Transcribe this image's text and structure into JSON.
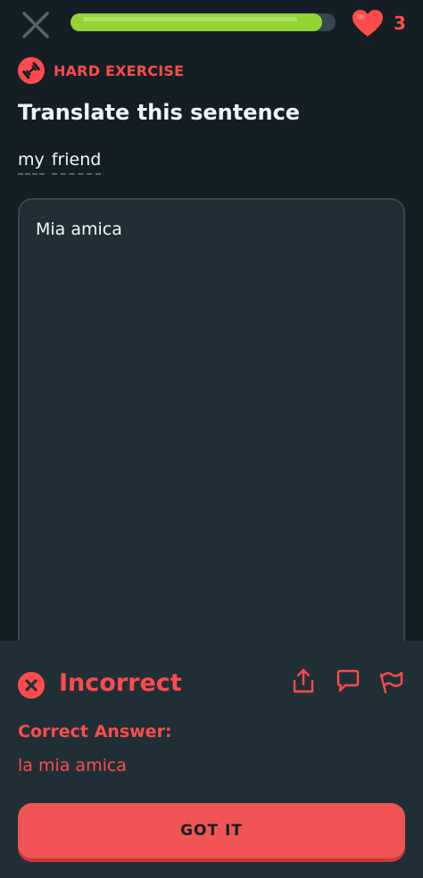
{
  "header": {
    "close_icon": "close-icon",
    "progress": 0.95,
    "hearts_icon": "heart-icon",
    "hearts_count": "3",
    "colors": {
      "progress": "#93d333",
      "track": "#37464f",
      "heart": "#ff4b4b"
    }
  },
  "exercise": {
    "badge_icon": "dumbbell-icon",
    "badge_label": "HARD EXERCISE",
    "title": "Translate this sentence",
    "source_words": [
      "my",
      "friend"
    ]
  },
  "answer": {
    "value": "Mia amica"
  },
  "feedback": {
    "status_icon": "x-circle-icon",
    "status": "Incorrect",
    "actions": [
      "share-icon",
      "comment-icon",
      "flag-icon"
    ],
    "correct_label": "Correct Answer:",
    "correct_answer": "la mia amica",
    "button_label": "GOT IT",
    "colors": {
      "accent": "#ff4b4b",
      "button": "#f05454",
      "background": "#202f36"
    }
  }
}
